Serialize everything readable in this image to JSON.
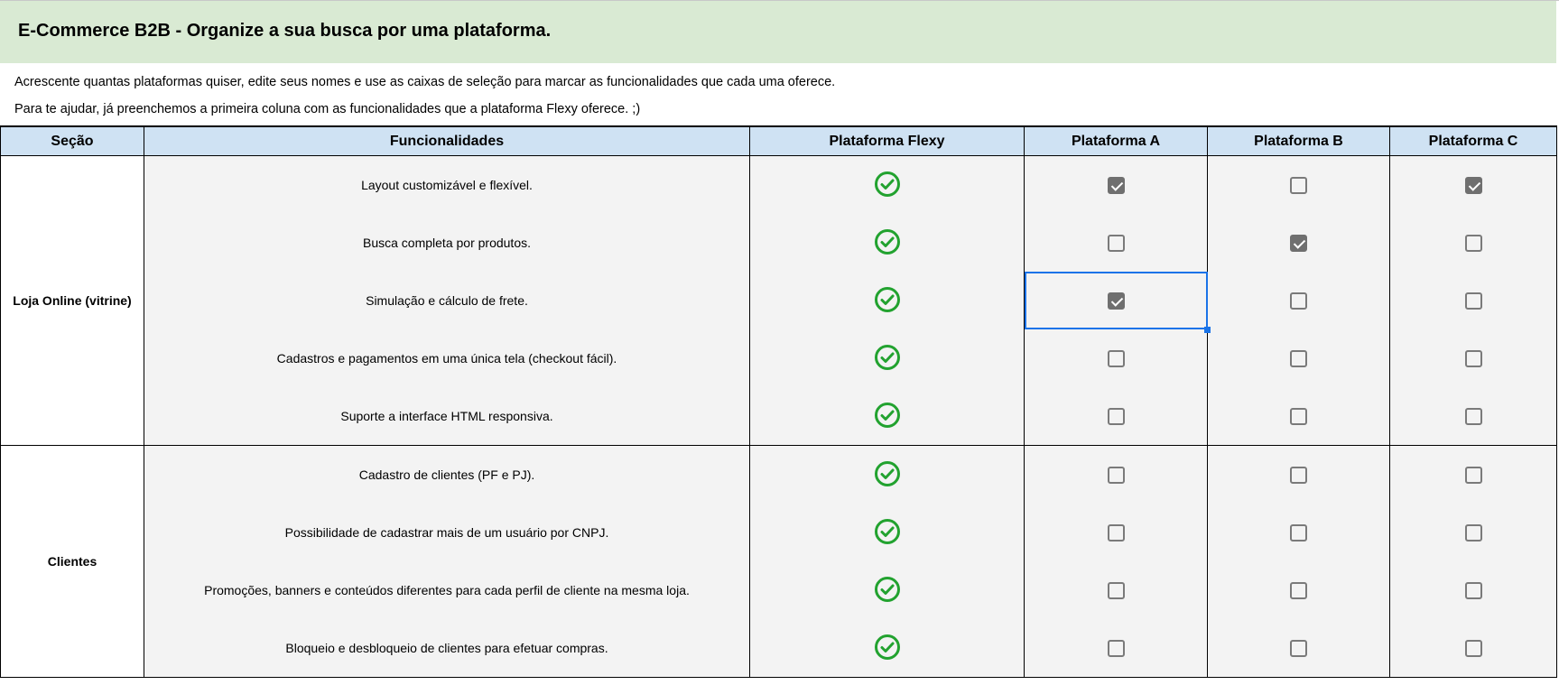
{
  "title": "E-Commerce B2B - Organize a sua busca por uma plataforma.",
  "intro": [
    "Acrescente quantas plataformas quiser, edite seus nomes e use as caixas de seleção para marcar as funcionalidades que cada uma oferece.",
    "Para te ajudar, já preenchemos a primeira coluna com as funcionalidades que a plataforma Flexy oferece. ;)"
  ],
  "headers": {
    "section": "Seção",
    "features": "Funcionalidades",
    "flexy": "Plataforma Flexy",
    "a": "Plataforma A",
    "b": "Plataforma B",
    "c": "Plataforma C"
  },
  "colors": {
    "banner": "#d9ead3",
    "header": "#cfe2f3",
    "check_green": "#22a22f",
    "selection": "#1a73e8"
  },
  "sections": [
    {
      "name": "Loja Online (vitrine)",
      "rows": [
        {
          "feature": "Layout customizável e flexível.",
          "flexy": true,
          "a": true,
          "b": false,
          "c": true
        },
        {
          "feature": "Busca completa por produtos.",
          "flexy": true,
          "a": false,
          "b": true,
          "c": false
        },
        {
          "feature": "Simulação e cálculo de frete.",
          "flexy": true,
          "a": true,
          "b": false,
          "c": false,
          "selected": "a"
        },
        {
          "feature": "Cadastros e pagamentos em uma única tela (checkout fácil).",
          "flexy": true,
          "a": false,
          "b": false,
          "c": false
        },
        {
          "feature": "Suporte a interface HTML responsiva.",
          "flexy": true,
          "a": false,
          "b": false,
          "c": false
        }
      ]
    },
    {
      "name": "Clientes",
      "rows": [
        {
          "feature": "Cadastro de clientes (PF e PJ).",
          "flexy": true,
          "a": false,
          "b": false,
          "c": false
        },
        {
          "feature": "Possibilidade de cadastrar mais de um usuário por CNPJ.",
          "flexy": true,
          "a": false,
          "b": false,
          "c": false
        },
        {
          "feature": "Promoções, banners e conteúdos diferentes para cada perfil de cliente na mesma loja.",
          "flexy": true,
          "a": false,
          "b": false,
          "c": false
        },
        {
          "feature": "Bloqueio e desbloqueio de clientes para efetuar compras.",
          "flexy": true,
          "a": false,
          "b": false,
          "c": false
        }
      ]
    }
  ]
}
